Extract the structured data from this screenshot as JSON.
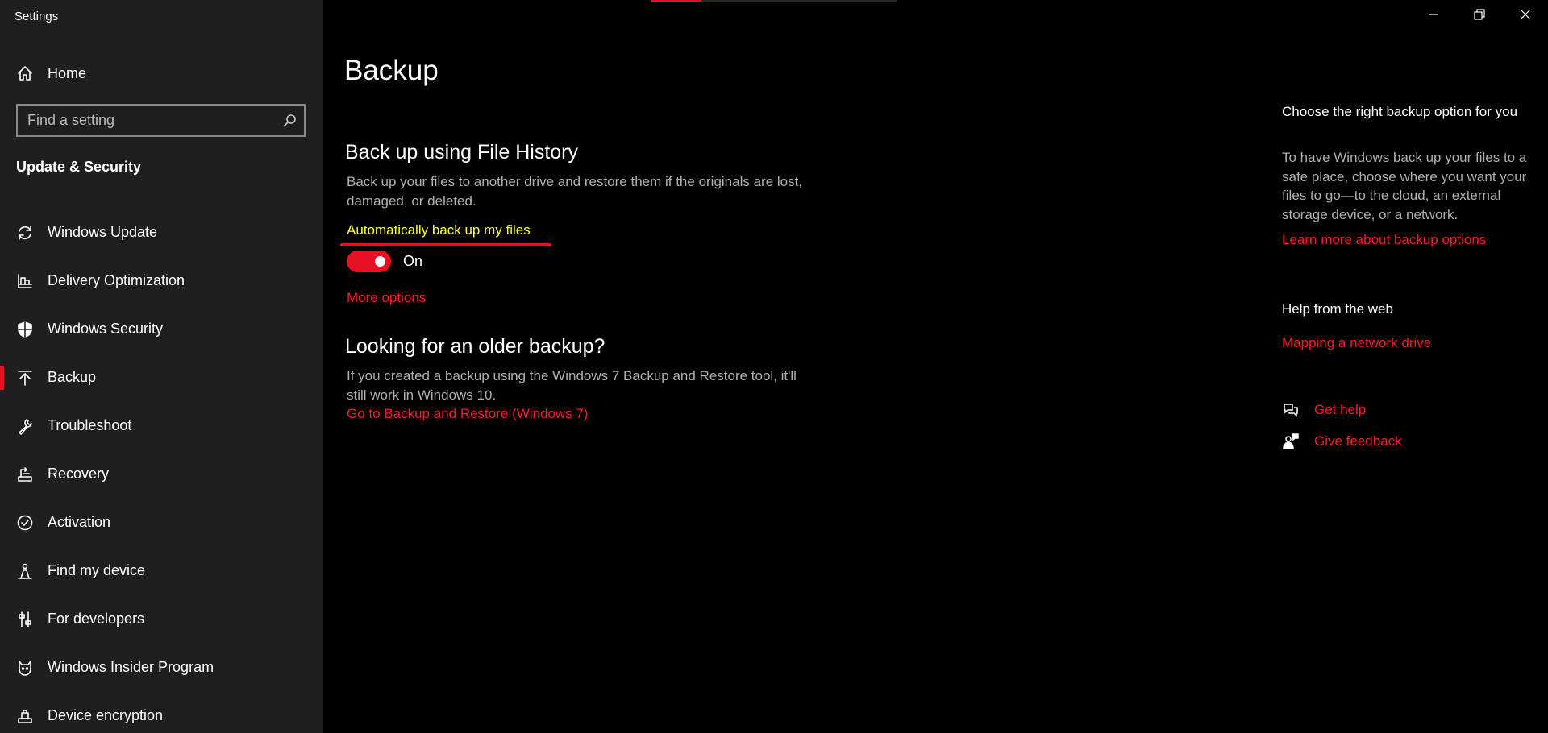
{
  "window": {
    "title": "Settings",
    "controls": [
      "minimize",
      "maximize",
      "close"
    ]
  },
  "sidebar": {
    "home_label": "Home",
    "search_placeholder": "Find a setting",
    "section_title": "Update & Security",
    "items": [
      {
        "label": "Windows Update",
        "icon": "refresh-icon",
        "active": false
      },
      {
        "label": "Delivery Optimization",
        "icon": "delivery-optimization-icon",
        "active": false
      },
      {
        "label": "Windows Security",
        "icon": "shield-icon",
        "active": false
      },
      {
        "label": "Backup",
        "icon": "backup-arrow-icon",
        "active": true
      },
      {
        "label": "Troubleshoot",
        "icon": "wrench-icon",
        "active": false
      },
      {
        "label": "Recovery",
        "icon": "recovery-icon",
        "active": false
      },
      {
        "label": "Activation",
        "icon": "check-circle-icon",
        "active": false
      },
      {
        "label": "Find my device",
        "icon": "person-location-icon",
        "active": false
      },
      {
        "label": "For developers",
        "icon": "developer-sliders-icon",
        "active": false
      },
      {
        "label": "Windows Insider Program",
        "icon": "cat-icon",
        "active": false
      },
      {
        "label": "Device encryption",
        "icon": "encryption-icon",
        "active": false
      }
    ]
  },
  "main": {
    "page_title": "Backup",
    "file_history": {
      "heading": "Back up using File History",
      "description": "Back up your files to another drive and restore them if the originals are lost, damaged, or deleted.",
      "toggle_label": "Automatically back up my files",
      "toggle_state": "On",
      "toggle_on": true,
      "more_options": "More options"
    },
    "older_backup": {
      "heading": "Looking for an older backup?",
      "description": "If you created a backup using the Windows 7 Backup and Restore tool, it'll still work in Windows 10.",
      "link": "Go to Backup and Restore (Windows 7)"
    }
  },
  "right_panel": {
    "choose_title": "Choose the right backup option for you",
    "choose_description": "To have Windows back up your files to a safe place, choose where you want your files to go—to the cloud, an external storage device, or a network.",
    "learn_more_link": "Learn more about backup options",
    "help_title": "Help from the web",
    "help_link": "Mapping a network drive",
    "get_help": "Get help",
    "give_feedback": "Give feedback"
  },
  "colors": {
    "accent": "#e81123",
    "link": "#ff1a2b",
    "highlight_text": "#ffff33",
    "sidebar_bg": "#1f1f1f",
    "main_bg": "#000000"
  }
}
